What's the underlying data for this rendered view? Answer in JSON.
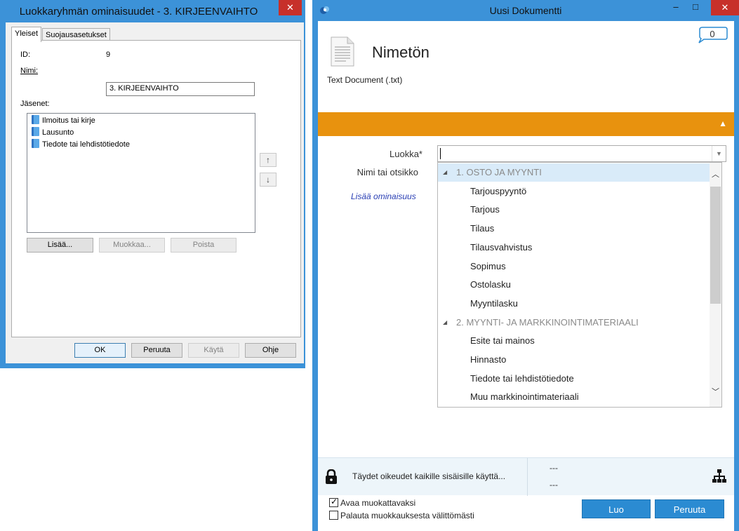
{
  "dialog1": {
    "title": "Luokkaryhmän ominaisuudet - 3. KIRJEENVAIHTO",
    "close": "✕",
    "tabs": [
      {
        "label": "Yleiset"
      },
      {
        "label": "Suojausasetukset"
      }
    ],
    "id_label": "ID:",
    "id_value": "9",
    "name_label": "Nimi:",
    "name_value": "3. KIRJEENVAIHTO",
    "members_label": "Jäsenet:",
    "members": [
      "Ilmoitus tai kirje",
      "Lausunto",
      "Tiedote tai lehdistötiedote"
    ],
    "up_arrow": "↑",
    "down_arrow": "↓",
    "add_button": "Lisää...",
    "edit_button": "Muokkaa...",
    "remove_button": "Poista",
    "ok_button": "OK",
    "cancel_button": "Peruuta",
    "apply_button": "Käytä",
    "help_button": "Ohje"
  },
  "window2": {
    "title": "Uusi Dokumentti",
    "minimize": "–",
    "maximize": "□",
    "close": "✕",
    "doc_name": "Nimetön",
    "doc_type": "Text Document (.txt)",
    "comment_count": "0",
    "collapse_arrow": "▲",
    "class_label": "Luokka*",
    "name_label": "Nimi tai otsikko",
    "add_property": "Lisää ominaisuus",
    "dropdown_arrow": "▼",
    "list": [
      {
        "text": "1. OSTO JA MYYNTI",
        "kind": "cat"
      },
      {
        "text": "Tarjouspyyntö",
        "kind": "sub"
      },
      {
        "text": "Tarjous",
        "kind": "sub"
      },
      {
        "text": "Tilaus",
        "kind": "sub"
      },
      {
        "text": "Tilausvahvistus",
        "kind": "sub"
      },
      {
        "text": "Sopimus",
        "kind": "sub"
      },
      {
        "text": "Ostolasku",
        "kind": "sub"
      },
      {
        "text": "Myyntilasku",
        "kind": "sub"
      },
      {
        "text": "2. MYYNTI- JA MARKKINOINTIMATERIAALI",
        "kind": "cat"
      },
      {
        "text": "Esite tai mainos",
        "kind": "sub"
      },
      {
        "text": "Hinnasto",
        "kind": "sub"
      },
      {
        "text": "Tiedote tai lehdistötiedote",
        "kind": "sub"
      },
      {
        "text": "Muu markkinointimateriaali",
        "kind": "sub"
      }
    ],
    "collapse_marker": "◢",
    "scroll_up": "︿",
    "scroll_down": "﹀",
    "rights_text": "Täydet oikeudet kaikille sisäisille käyttä...",
    "dash1": "---",
    "dash2": "---",
    "open_editable_label": "Avaa muokattavaksi",
    "open_editable_checked": true,
    "return_label": "Palauta muokkauksesta välittömästi",
    "return_checked": false,
    "create_button": "Luo",
    "cancel_button": "Peruuta",
    "colors": {
      "accent": "#e8920e",
      "button": "#2b8bd2",
      "title_bar": "#3c92d8",
      "close": "#c7302a"
    }
  }
}
